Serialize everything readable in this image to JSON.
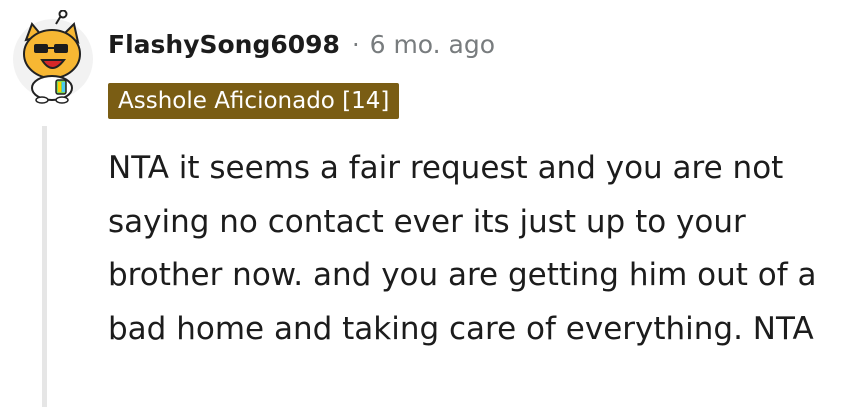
{
  "comment": {
    "username": "FlashySong6098",
    "separator": "·",
    "timestamp": "6 mo. ago",
    "flair": {
      "text": "Asshole Aficionado [14]",
      "color": "#7a5d14"
    },
    "body": "NTA it seems a fair request and you are not saying no contact ever its just up to your brother now. and you are getting him out of a bad home and taking care of everything. NTA",
    "avatar_icon": "snoo-avatar-icon"
  },
  "colors": {
    "text": "#1c1c1c",
    "meta": "#787c7e",
    "thread_line": "#e6e6e6"
  }
}
